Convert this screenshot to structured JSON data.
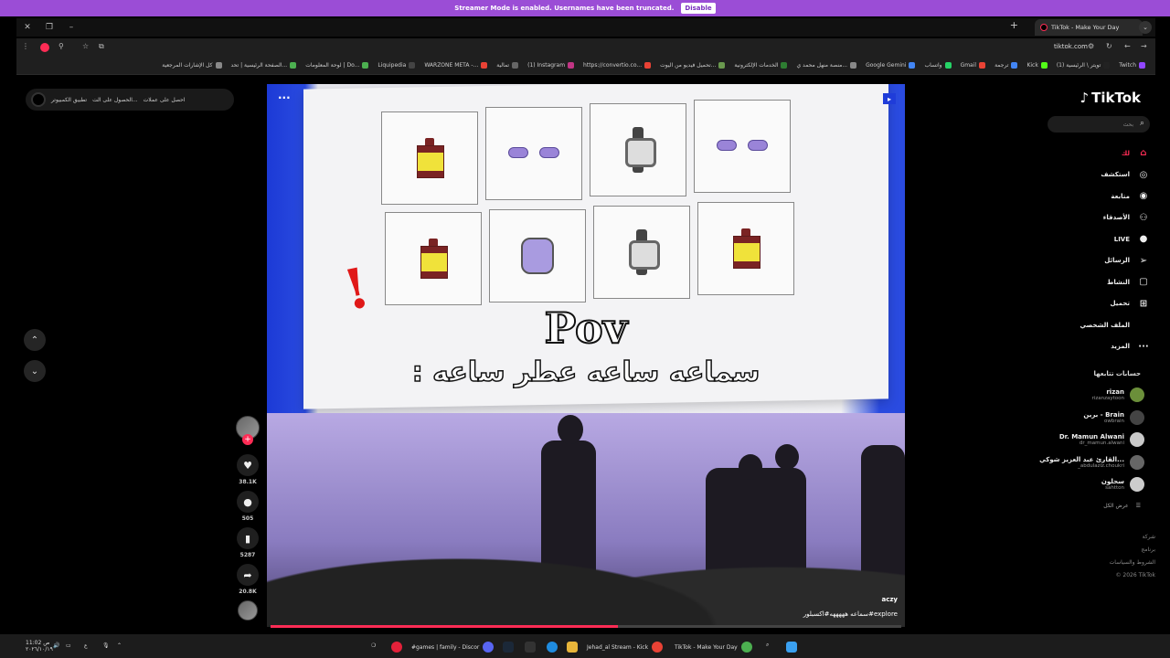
{
  "banner": {
    "text": "Streamer Mode is enabled. Usernames have been truncated.",
    "button": "Disable"
  },
  "browser": {
    "active_tab": "TikTok - Make Your Day",
    "url": "tiktok.com",
    "bookmarks": [
      "Twitch",
      "(1) تويتر \\ الرئيسية",
      "Kick",
      "ترجمة",
      "Gmail",
      "واتساب",
      "Google Gemini",
      "منصة منهل محمد ي...",
      "الخدمات الإلكترونية",
      "تحميل فيديو من اليوت...",
      "https://convertio.co...",
      "(1) Instagram",
      "تمالية",
      "WARZONE META -...",
      "Liquipedia",
      "لوحة المعلومات | Do...",
      "الصفحة الرئيسية | تحد...",
      "كل الإشارات المرجعية"
    ]
  },
  "left": {
    "pill": {
      "get_coins": "احصل على عملات",
      "get_app": "الحصول على الت...",
      "desktop_app": "تطبيق الكمبيوتر"
    },
    "up_icon": "chevron-up-icon",
    "down_icon": "chevron-down-icon"
  },
  "video": {
    "overlay_title": "Pov",
    "overlay_caption": "سماعه ساعه عطر ساعه :",
    "username": "aczy",
    "description": "سماعه هههههه#اكسبلور#explore",
    "progress": 0.55
  },
  "actions": {
    "likes": "38.1K",
    "comments": "505",
    "saves": "5287",
    "shares": "20.8K"
  },
  "sidebar": {
    "logo": "TikTok",
    "search_placeholder": "بحث",
    "menu": [
      {
        "label": "لك",
        "icon": "home-icon",
        "active": true
      },
      {
        "label": "استكشف",
        "icon": "compass-icon",
        "active": false
      },
      {
        "label": "متابعة",
        "icon": "avatar-icon",
        "active": false
      },
      {
        "label": "الأصدقاء",
        "icon": "friends-icon",
        "active": false
      },
      {
        "label": "LIVE",
        "icon": "live-icon",
        "active": false
      },
      {
        "label": "الرسائل",
        "icon": "send-icon",
        "active": false
      },
      {
        "label": "النشاط",
        "icon": "activity-icon",
        "active": false
      },
      {
        "label": "تحميل",
        "icon": "upload-icon",
        "active": false
      },
      {
        "label": "الملف الشخصي",
        "icon": "",
        "active": false
      },
      {
        "label": "المزيد",
        "icon": "more-icon",
        "active": false
      }
    ],
    "following_title": "حسابات تتابعها",
    "accounts": [
      {
        "name": "rizan",
        "handle": "rizanzaytoon"
      },
      {
        "name": "برين - Brain",
        "handle": "owbrain"
      },
      {
        "name": "Dr. Mamun Alwani",
        "handle": "dr_mamun.alwani"
      },
      {
        "name": "القارئ عبد العزيز شوكي...",
        "handle": "_abdulaziz.choukri"
      },
      {
        "name": "سحلون",
        "handle": "sahtton"
      }
    ],
    "see_all": "عرض الكل",
    "footer": [
      "شركة",
      "برنامج",
      "الشروط والسياسات",
      "© 2026 TikTok"
    ]
  },
  "taskbar": {
    "apps": [
      "#games | family - Discor",
      "Jehad_al Stream - Kick",
      "TikTok - Make Your Day"
    ],
    "time": "11:02 ص",
    "date": "٢٠٢٦/١٠/١٩"
  },
  "colors": {
    "accent": "#fe2c55",
    "banner": "#9b4dd6"
  }
}
